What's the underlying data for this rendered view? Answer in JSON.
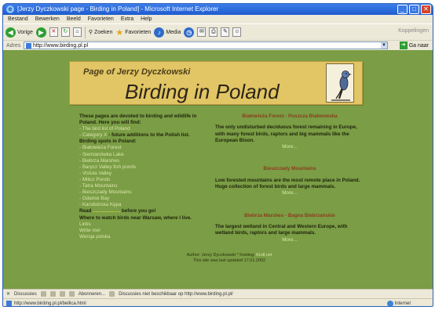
{
  "window": {
    "title": "[Jerzy Dyczkowski page - Birding in Poland] - Microsoft Internet Explorer",
    "minimize": "_",
    "maximize": "□",
    "close": "✕"
  },
  "menu": [
    "Bestand",
    "Bewerken",
    "Beeld",
    "Favorieten",
    "Extra",
    "Help"
  ],
  "toolbar": {
    "back": "Vorige",
    "search": "Zoeken",
    "favorites": "Favorieten",
    "media": "Media",
    "right": "Koppelingen"
  },
  "address": {
    "label": "Adres",
    "url": "http://www.birding.pl.pl",
    "go": "Ga naar"
  },
  "page": {
    "subtitle": "Page of Jerzy Dyczkowski",
    "title": "Birding in Poland",
    "intro": "These pages are devoted to birding and wildlife in Poland. Here you will find:",
    "links": [
      "- The bird list of Poland",
      "- Category X"
    ],
    "cat_x_note": "- future additions to the Polish list.",
    "spots_heading": "Birding spots in Poland:",
    "spots": [
      "- Białowieża Forest",
      "- Siemianówka Lake",
      "- Biebrza Marshes",
      "- Barycz Valley fish ponds",
      "- Vistula Valley",
      "- Milicz Ponds",
      "- Tatra Mountains",
      "- Bieszczady Mountains",
      "- Gdańsk Bay",
      "- Karsibórska Kępa"
    ],
    "read_prefix": "Read",
    "read_link": "....................",
    "read_suffix": "before you go!",
    "where_text": "Where to watch birds near Warsaw, where I live.",
    "nav": [
      "Links",
      "Write me!",
      "Wersja polska"
    ]
  },
  "sections": [
    {
      "title": "Białowieża Forest - Puszcza Białowieska",
      "text": "The only undisturbed deciduous forest remaining in Europe, with many forest birds, raptors and big mammals like the European Bison.",
      "more": "More..."
    },
    {
      "title": "Bieszczady Mountains",
      "text": "Low forested mountains are the most remote place in Poland. Huge collection of forest birds and large mammals.",
      "more": "More..."
    },
    {
      "title": "Biebrza Marshes - Bagna Biebrzańskie",
      "text": "The largest wetland in Central and Western Europe, with wetland birds, raptors and large mammals.",
      "more": "More..."
    }
  ],
  "footer": {
    "author": "Author: Jerzy Dyczkowski * hosting:",
    "host": "Kroll.net",
    "updated": "This site was last updated 17.01.2002"
  },
  "linksbar": {
    "discuss": "Discussies",
    "notice": "Abonneren...",
    "status_msg": "Discussies niet beschikbaar op http://www.birding.pl.pl/"
  },
  "statusbar": {
    "url": "http://www.birding.pl.pl/bellica.html",
    "zone": "Internet"
  }
}
